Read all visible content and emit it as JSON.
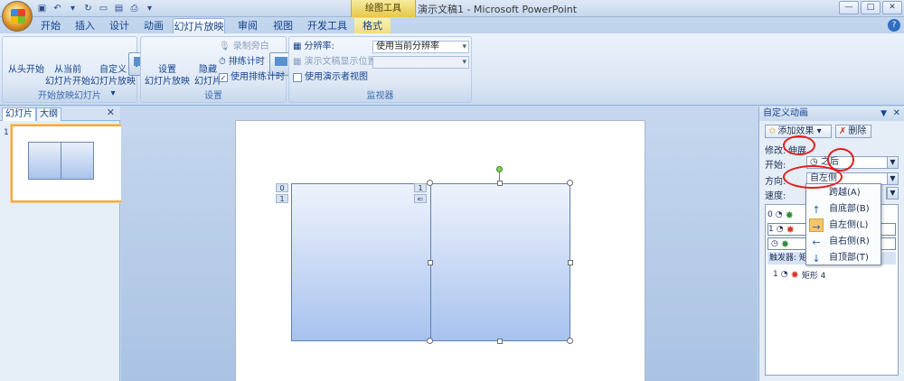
{
  "titlebar": {
    "title": "演示文稿1 - Microsoft PowerPoint",
    "context_tools": "绘图工具"
  },
  "tabs": [
    "开始",
    "插入",
    "设计",
    "动画",
    "幻灯片放映",
    "审阅",
    "视图",
    "开发工具",
    "格式"
  ],
  "ribbon": {
    "group1": {
      "label": "开始放映幻灯片",
      "btn_from_start": "从头开始",
      "btn_from_current_1": "从当前",
      "btn_from_current_2": "幻灯片开始",
      "btn_custom_1": "自定义",
      "btn_custom_2": "幻灯片放映 ▾"
    },
    "group2": {
      "label": "设置",
      "btn_setup_1": "设置",
      "btn_setup_2": "幻灯片放映",
      "btn_hide_1": "隐藏",
      "btn_hide_2": "幻灯片",
      "record": "录制旁白",
      "rehearse": "排练计时",
      "use_timings": "使用排练计时"
    },
    "group3": {
      "label": "监视器",
      "resolution_label": "分辨率:",
      "resolution_value": "使用当前分辨率",
      "show_on_label": "演示文稿显示位置:",
      "presenter_view": "使用演示者视图"
    }
  },
  "left_panel": {
    "tab_slides": "幻灯片",
    "tab_outline": "大纲",
    "slide_num": "1"
  },
  "slide": {
    "tag0": "0",
    "tag1": "1",
    "tag2": "1"
  },
  "task_pane": {
    "title": "自定义动画",
    "add_effect": "添加效果 ▾",
    "delete": "删除",
    "modify_label": "修改:",
    "modify_value": "伸展",
    "start_label": "开始:",
    "start_value": "之后",
    "direction_label": "方向:",
    "direction_value": "自左侧",
    "speed_label": "速度:",
    "list_items": [
      {
        "num": "0",
        "name": ""
      },
      {
        "num": "1",
        "name": ""
      },
      {
        "num": "",
        "name": ""
      }
    ],
    "trigger_label": "触发器: 矩",
    "trigger_item_num": "1",
    "trigger_item_name": "矩形 4"
  },
  "dropdown_menu": [
    {
      "icon": "",
      "label": "跨越(A)"
    },
    {
      "icon": "arrow-up-icon",
      "label": "自底部(B)"
    },
    {
      "icon": "arrow-right-icon",
      "label": "自左侧(L)"
    },
    {
      "icon": "arrow-left-icon",
      "label": "自右侧(R)"
    },
    {
      "icon": "arrow-down-icon",
      "label": "自顶部(T)"
    }
  ]
}
